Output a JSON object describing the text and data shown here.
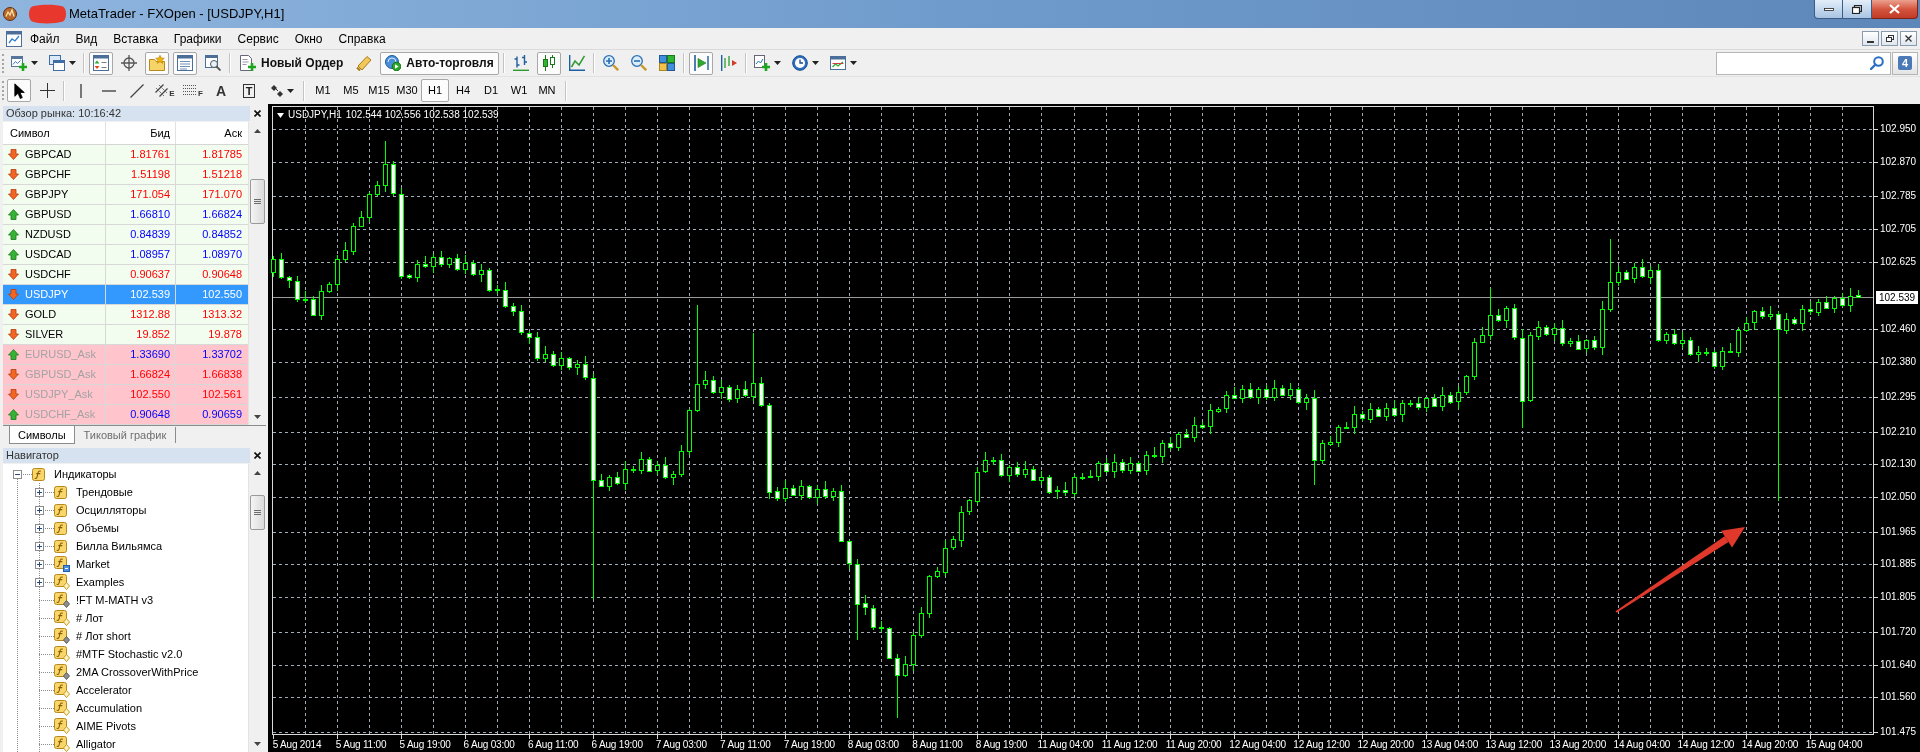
{
  "title_bar": {
    "title": "MetaTrader - FXOpen - [USDJPY,H1]"
  },
  "menu": [
    {
      "label": "Файл"
    },
    {
      "label": "Вид"
    },
    {
      "label": "Вставка"
    },
    {
      "label": "Графики"
    },
    {
      "label": "Сервис"
    },
    {
      "label": "Окно"
    },
    {
      "label": "Справка"
    }
  ],
  "toolbar": {
    "groups": [
      [
        {
          "kind": "new_chart",
          "dropdown": true,
          "pressed": false
        },
        {
          "kind": "profiles",
          "dropdown": true,
          "pressed": false
        }
      ],
      [
        {
          "kind": "market_watch",
          "pressed": true
        },
        {
          "kind": "data_window",
          "pressed": false
        },
        {
          "kind": "navigator",
          "pressed": true
        },
        {
          "kind": "terminal",
          "pressed": true
        },
        {
          "kind": "tester",
          "pressed": false
        }
      ],
      [
        {
          "kind": "new_order",
          "label": "Новый Ордер",
          "pressed": false
        },
        {
          "kind": "experts",
          "pressed": false
        },
        {
          "kind": "autotrading",
          "label": "Авто-торговля",
          "pressed": true
        }
      ],
      [
        {
          "kind": "bar_chart",
          "pressed": false
        },
        {
          "kind": "candle_chart",
          "pressed": true
        },
        {
          "kind": "line_chart",
          "pressed": false
        }
      ],
      [
        {
          "kind": "zoom_in",
          "pressed": false
        },
        {
          "kind": "zoom_out",
          "pressed": false
        },
        {
          "kind": "tile",
          "pressed": false
        }
      ],
      [
        {
          "kind": "autoscroll",
          "pressed": true
        },
        {
          "kind": "chart_shift",
          "pressed": false
        }
      ],
      [
        {
          "kind": "indicators",
          "dropdown": true,
          "pressed": false
        },
        {
          "kind": "periods",
          "dropdown": true,
          "pressed": false
        },
        {
          "kind": "templates",
          "dropdown": true,
          "pressed": false
        }
      ]
    ]
  },
  "messages": {
    "count": "4"
  },
  "drawing_tools": {
    "groups": [
      [
        {
          "kind": "cursor",
          "pressed": true
        },
        {
          "kind": "crosshair",
          "pressed": false
        }
      ],
      [
        {
          "kind": "vertical_line",
          "pressed": false
        },
        {
          "kind": "horizontal_line",
          "pressed": false
        },
        {
          "kind": "trend_line",
          "pressed": false
        },
        {
          "kind": "channel",
          "glyph": "E",
          "pressed": false
        },
        {
          "kind": "fibonacci",
          "glyph": "F",
          "pressed": false
        },
        {
          "kind": "text",
          "glyph": "A",
          "pressed": false
        },
        {
          "kind": "label",
          "glyph": "T",
          "pressed": false
        },
        {
          "kind": "arrows",
          "dropdown": true,
          "pressed": false
        }
      ]
    ]
  },
  "timeframes": [
    {
      "label": "M1",
      "selected": false
    },
    {
      "label": "M5",
      "selected": false
    },
    {
      "label": "M15",
      "selected": false
    },
    {
      "label": "M30",
      "selected": false
    },
    {
      "label": "H1",
      "selected": true
    },
    {
      "label": "H4",
      "selected": false
    },
    {
      "label": "D1",
      "selected": false
    },
    {
      "label": "W1",
      "selected": false
    },
    {
      "label": "MN",
      "selected": false
    }
  ],
  "market_watch": {
    "title": "Обзор рынка: 10:16:42",
    "columns": [
      "Символ",
      "Бид",
      "Аск"
    ],
    "rows": [
      {
        "symbol": "GBPCAD",
        "bid": "1.81761",
        "ask": "1.81785",
        "kind": "down",
        "selected": false,
        "disabled": false
      },
      {
        "symbol": "GBPCHF",
        "bid": "1.51198",
        "ask": "1.51218",
        "kind": "down",
        "selected": false,
        "disabled": false
      },
      {
        "symbol": "GBPJPY",
        "bid": "171.054",
        "ask": "171.070",
        "kind": "down",
        "selected": false,
        "disabled": false
      },
      {
        "symbol": "GBPUSD",
        "bid": "1.66810",
        "ask": "1.66824",
        "kind": "up",
        "selected": false,
        "disabled": false
      },
      {
        "symbol": "NZDUSD",
        "bid": "0.84839",
        "ask": "0.84852",
        "kind": "up",
        "selected": false,
        "disabled": false
      },
      {
        "symbol": "USDCAD",
        "bid": "1.08957",
        "ask": "1.08970",
        "kind": "up",
        "selected": false,
        "disabled": false
      },
      {
        "symbol": "USDCHF",
        "bid": "0.90637",
        "ask": "0.90648",
        "kind": "down",
        "selected": false,
        "disabled": false
      },
      {
        "symbol": "USDJPY",
        "bid": "102.539",
        "ask": "102.550",
        "kind": "down",
        "selected": true,
        "disabled": false
      },
      {
        "symbol": "GOLD",
        "bid": "1312.88",
        "ask": "1313.32",
        "kind": "down",
        "selected": false,
        "disabled": false
      },
      {
        "symbol": "SILVER",
        "bid": "19.852",
        "ask": "19.878",
        "kind": "down",
        "selected": false,
        "disabled": false
      },
      {
        "symbol": "EURUSD_Ask",
        "bid": "1.33690",
        "ask": "1.33702",
        "kind": "up",
        "selected": false,
        "disabled": true
      },
      {
        "symbol": "GBPUSD_Ask",
        "bid": "1.66824",
        "ask": "1.66838",
        "kind": "down",
        "selected": false,
        "disabled": true
      },
      {
        "symbol": "USDJPY_Ask",
        "bid": "102.550",
        "ask": "102.561",
        "kind": "down",
        "selected": false,
        "disabled": true
      },
      {
        "symbol": "USDCHF_Ask",
        "bid": "0.90648",
        "ask": "0.90659",
        "kind": "up",
        "selected": false,
        "disabled": true
      }
    ],
    "tabs": [
      {
        "label": "Символы",
        "selected": true
      },
      {
        "label": "Тиковый график",
        "selected": false
      }
    ]
  },
  "navigator": {
    "title": "Навигатор",
    "tree": [
      {
        "label": "Индикаторы",
        "kind": "category",
        "expanded": true,
        "children": [
          {
            "label": "Трендовые",
            "kind": "category",
            "expanded": false
          },
          {
            "label": "Осцилляторы",
            "kind": "category",
            "expanded": false
          },
          {
            "label": "Объемы",
            "kind": "category",
            "expanded": false
          },
          {
            "label": "Билла Вильямса",
            "kind": "category",
            "expanded": false
          },
          {
            "label": "Market",
            "kind": "market",
            "expanded": false
          },
          {
            "label": "Examples",
            "kind": "source",
            "expanded": false
          },
          {
            "label": "!FT M-MATH v3",
            "kind": "compiled"
          },
          {
            "label": "# Лот",
            "kind": "source"
          },
          {
            "label": "# Лот short",
            "kind": "compiled"
          },
          {
            "label": "#MTF Stochastic v2.0",
            "kind": "source"
          },
          {
            "label": "2MA CrossoverWithPrice",
            "kind": "compiled"
          },
          {
            "label": "Accelerator",
            "kind": "source"
          },
          {
            "label": "Accumulation",
            "kind": "source"
          },
          {
            "label": "AIME Pivots",
            "kind": "source"
          },
          {
            "label": "Alligator",
            "kind": "source"
          }
        ]
      }
    ]
  },
  "chart": {
    "symbol": "USDJPY,H1",
    "quote": "102.544 102.556 102.538 102.539",
    "chart_data": {
      "type": "candlestick",
      "grid": true,
      "ylim": [
        101.469,
        103.005
      ],
      "categories": [
        null,
        null,
        null,
        "5 Aug 2014",
        null,
        null,
        null,
        null,
        null,
        null,
        null,
        "5 Aug 11:00",
        null,
        null,
        null,
        null,
        null,
        null,
        null,
        "5 Aug 19:00",
        null,
        null,
        null,
        null,
        null,
        null,
        null,
        "6 Aug 03:00",
        null,
        null,
        null,
        null,
        null,
        null,
        null,
        "6 Aug 11:00",
        null,
        null,
        null,
        null,
        null,
        null,
        null,
        "6 Aug 19:00",
        null,
        null,
        null,
        null,
        null,
        null,
        null,
        "7 Aug 03:00",
        null,
        null,
        null,
        null,
        null,
        null,
        null,
        "7 Aug 11:00",
        null,
        null,
        null,
        null,
        null,
        null,
        null,
        "7 Aug 19:00",
        null,
        null,
        null,
        null,
        null,
        null,
        null,
        "8 Aug 03:00",
        null,
        null,
        null,
        null,
        null,
        null,
        null,
        "8 Aug 11:00",
        null,
        null,
        null,
        null,
        null,
        null,
        null,
        "8 Aug 19:00",
        null,
        null,
        null,
        null,
        null,
        null,
        null,
        "11 Aug 04:00",
        null,
        null,
        null,
        null,
        null,
        null,
        null,
        "11 Aug 12:00",
        null,
        null,
        null,
        null,
        null,
        null,
        null,
        "11 Aug 20:00",
        null,
        null,
        null,
        null,
        null,
        null,
        null,
        "12 Aug 04:00",
        null,
        null,
        null,
        null,
        null,
        null,
        null,
        "12 Aug 12:00",
        null,
        null,
        null,
        null,
        null,
        null,
        null,
        "12 Aug 20:00",
        null,
        null,
        null,
        null,
        null,
        null,
        null,
        "13 Aug 04:00",
        null,
        null,
        null,
        null,
        null,
        null,
        null,
        "13 Aug 12:00",
        null,
        null,
        null,
        null,
        null,
        null,
        null,
        "13 Aug 20:00",
        null,
        null,
        null,
        null,
        null,
        null,
        null,
        "14 Aug 04:00",
        null,
        null,
        null,
        null,
        null,
        null,
        null,
        "14 Aug 12:00",
        null,
        null,
        null,
        null,
        null,
        null,
        null,
        "14 Aug 20:00",
        null,
        null,
        null,
        null,
        null,
        null,
        null,
        "15 Aug 04:00",
        null,
        null,
        null
      ],
      "ohlc": [
        [
          102.6,
          102.64,
          102.588,
          102.632
        ],
        [
          102.632,
          102.647,
          102.582,
          102.587
        ],
        [
          102.587,
          102.591,
          102.561,
          102.579
        ],
        [
          102.579,
          102.59,
          102.528,
          102.535
        ],
        [
          102.535,
          102.555,
          102.524,
          102.534
        ],
        [
          102.534,
          102.542,
          102.493,
          102.496
        ],
        [
          102.496,
          102.569,
          102.484,
          102.554
        ],
        [
          102.554,
          102.576,
          102.549,
          102.572
        ],
        [
          102.572,
          102.643,
          102.554,
          102.632
        ],
        [
          102.632,
          102.673,
          102.625,
          102.653
        ],
        [
          102.653,
          102.721,
          102.643,
          102.713
        ],
        [
          102.713,
          102.75,
          102.71,
          102.735
        ],
        [
          102.735,
          102.796,
          102.723,
          102.792
        ],
        [
          102.792,
          102.824,
          102.787,
          102.813
        ],
        [
          102.813,
          102.92,
          102.795,
          102.864
        ],
        [
          102.864,
          102.872,
          102.785,
          102.792
        ],
        [
          102.792,
          102.807,
          102.582,
          102.592
        ],
        [
          102.592,
          102.596,
          102.584,
          102.587
        ],
        [
          102.587,
          102.63,
          102.575,
          102.619
        ],
        [
          102.619,
          102.639,
          102.61,
          102.615
        ],
        [
          102.615,
          102.644,
          102.597,
          102.636
        ],
        [
          102.636,
          102.651,
          102.612,
          102.619
        ],
        [
          102.619,
          102.638,
          102.609,
          102.634
        ],
        [
          102.634,
          102.645,
          102.604,
          102.607
        ],
        [
          102.607,
          102.642,
          102.595,
          102.622
        ],
        [
          102.622,
          102.63,
          102.59,
          102.595
        ],
        [
          102.595,
          102.621,
          102.577,
          102.606
        ],
        [
          102.606,
          102.61,
          102.551,
          102.558
        ],
        [
          102.558,
          102.569,
          102.546,
          102.556
        ],
        [
          102.556,
          102.576,
          102.513,
          102.516
        ],
        [
          102.516,
          102.524,
          102.492,
          102.504
        ],
        [
          102.504,
          102.519,
          102.447,
          102.452
        ],
        [
          102.452,
          102.456,
          102.424,
          102.442
        ],
        [
          102.442,
          102.453,
          102.383,
          102.39
        ],
        [
          102.39,
          102.419,
          102.38,
          102.399
        ],
        [
          102.399,
          102.407,
          102.369,
          102.372
        ],
        [
          102.372,
          102.404,
          102.36,
          102.389
        ],
        [
          102.389,
          102.393,
          102.361,
          102.366
        ],
        [
          102.366,
          102.385,
          102.348,
          102.374
        ],
        [
          102.374,
          102.394,
          102.335,
          102.342
        ],
        [
          102.342,
          102.35,
          101.8,
          102.092
        ],
        [
          102.092,
          102.107,
          102.074,
          102.077
        ],
        [
          102.077,
          102.103,
          102.065,
          102.099
        ],
        [
          102.099,
          102.11,
          102.08,
          102.085
        ],
        [
          102.085,
          102.139,
          102.067,
          102.119
        ],
        [
          102.119,
          102.127,
          102.109,
          102.116
        ],
        [
          102.116,
          102.159,
          102.106,
          102.144
        ],
        [
          102.144,
          102.148,
          102.112,
          102.115
        ],
        [
          102.115,
          102.138,
          102.103,
          102.127
        ],
        [
          102.127,
          102.147,
          102.093,
          102.098
        ],
        [
          102.098,
          102.114,
          102.08,
          102.106
        ],
        [
          102.106,
          102.177,
          102.099,
          102.162
        ],
        [
          102.162,
          102.266,
          102.152,
          102.262
        ],
        [
          102.262,
          102.52,
          102.259,
          102.326
        ],
        [
          102.326,
          102.357,
          102.314,
          102.337
        ],
        [
          102.337,
          102.345,
          102.302,
          102.307
        ],
        [
          102.307,
          102.335,
          102.289,
          102.32
        ],
        [
          102.32,
          102.324,
          102.283,
          102.29
        ],
        [
          102.29,
          102.324,
          102.28,
          102.313
        ],
        [
          102.313,
          102.333,
          102.295,
          102.298
        ],
        [
          102.298,
          102.45,
          102.286,
          102.329
        ],
        [
          102.329,
          102.344,
          102.271,
          102.276
        ],
        [
          102.276,
          102.28,
          102.046,
          102.064
        ],
        [
          102.064,
          102.075,
          102.04,
          102.047
        ],
        [
          102.047,
          102.092,
          102.037,
          102.072
        ],
        [
          102.072,
          102.08,
          102.052,
          102.055
        ],
        [
          102.055,
          102.091,
          102.043,
          102.076
        ],
        [
          102.076,
          102.08,
          102.045,
          102.05
        ],
        [
          102.05,
          102.08,
          102.032,
          102.069
        ],
        [
          102.069,
          102.089,
          102.044,
          102.051
        ],
        [
          102.051,
          102.072,
          102.041,
          102.064
        ],
        [
          102.064,
          102.079,
          101.939,
          101.942
        ],
        [
          101.942,
          101.946,
          101.875,
          101.887
        ],
        [
          101.887,
          101.898,
          101.7,
          101.79
        ],
        [
          101.79,
          101.81,
          101.761,
          101.779
        ],
        [
          101.779,
          101.787,
          101.725,
          101.732
        ],
        [
          101.732,
          101.747,
          101.719,
          101.729
        ],
        [
          101.729,
          101.733,
          101.653,
          101.656
        ],
        [
          101.656,
          101.667,
          101.51,
          101.614
        ],
        [
          101.614,
          101.662,
          101.609,
          101.642
        ],
        [
          101.642,
          101.72,
          101.624,
          101.712
        ],
        [
          101.712,
          101.78,
          101.705,
          101.765
        ],
        [
          101.765,
          101.86,
          101.755,
          101.856
        ],
        [
          101.856,
          101.879,
          101.853,
          101.868
        ],
        [
          101.868,
          101.946,
          101.856,
          101.926
        ],
        [
          101.926,
          101.954,
          101.921,
          101.946
        ],
        [
          101.946,
          102.029,
          101.928,
          102.014
        ],
        [
          102.014,
          102.046,
          102.007,
          102.042
        ],
        [
          102.042,
          102.123,
          102.032,
          102.112
        ],
        [
          102.112,
          102.16,
          102.109,
          102.14
        ],
        [
          102.14,
          102.149,
          102.128,
          102.141
        ],
        [
          102.141,
          102.156,
          102.1,
          102.105
        ],
        [
          102.105,
          102.128,
          102.087,
          102.124
        ],
        [
          102.124,
          102.135,
          102.099,
          102.106
        ],
        [
          102.106,
          102.139,
          102.096,
          102.119
        ],
        [
          102.119,
          102.127,
          102.089,
          102.092
        ],
        [
          102.092,
          102.114,
          102.08,
          102.099
        ],
        [
          102.099,
          102.103,
          102.058,
          102.063
        ],
        [
          102.063,
          102.077,
          102.045,
          102.066
        ],
        [
          102.066,
          102.086,
          102.053,
          102.06
        ],
        [
          102.06,
          102.107,
          102.05,
          102.099
        ],
        [
          102.099,
          102.108,
          102.091,
          102.099
        ],
        [
          102.099,
          102.116,
          102.096,
          102.101
        ],
        [
          102.101,
          102.138,
          102.089,
          102.134
        ],
        [
          102.134,
          102.145,
          102.109,
          102.114
        ],
        [
          102.114,
          102.156,
          102.096,
          102.136
        ],
        [
          102.136,
          102.144,
          102.109,
          102.116
        ],
        [
          102.116,
          102.149,
          102.106,
          102.134
        ],
        [
          102.134,
          102.138,
          102.112,
          102.115
        ],
        [
          102.115,
          102.163,
          102.103,
          102.152
        ],
        [
          102.152,
          102.172,
          102.146,
          102.151
        ],
        [
          102.151,
          102.19,
          102.133,
          102.182
        ],
        [
          102.182,
          102.197,
          102.165,
          102.172
        ],
        [
          102.172,
          102.209,
          102.162,
          102.205
        ],
        [
          102.205,
          102.216,
          102.194,
          102.197
        ],
        [
          102.197,
          102.246,
          102.185,
          102.226
        ],
        [
          102.226,
          102.234,
          102.217,
          102.222
        ],
        [
          102.222,
          102.277,
          102.204,
          102.262
        ],
        [
          102.262,
          102.27,
          102.255,
          102.266
        ],
        [
          102.266,
          102.31,
          102.256,
          102.299
        ],
        [
          102.299,
          102.319,
          102.289,
          102.292
        ],
        [
          102.292,
          102.323,
          102.28,
          102.315
        ],
        [
          102.315,
          102.33,
          102.29,
          102.295
        ],
        [
          102.295,
          102.318,
          102.277,
          102.314
        ],
        [
          102.314,
          102.325,
          102.288,
          102.295
        ],
        [
          102.295,
          102.336,
          102.285,
          102.316
        ],
        [
          102.316,
          102.324,
          102.296,
          102.299
        ],
        [
          102.299,
          102.329,
          102.287,
          102.314
        ],
        [
          102.314,
          102.318,
          102.277,
          102.282
        ],
        [
          102.282,
          102.303,
          102.264,
          102.292
        ],
        [
          102.292,
          102.312,
          102.08,
          102.14
        ],
        [
          102.14,
          102.189,
          102.13,
          102.181
        ],
        [
          102.181,
          102.2,
          102.178,
          102.185
        ],
        [
          102.185,
          102.226,
          102.173,
          102.222
        ],
        [
          102.222,
          102.233,
          102.216,
          102.221
        ],
        [
          102.221,
          102.272,
          102.203,
          102.252
        ],
        [
          102.252,
          102.26,
          102.235,
          102.242
        ],
        [
          102.242,
          102.281,
          102.232,
          102.266
        ],
        [
          102.266,
          102.27,
          102.245,
          102.248
        ],
        [
          102.248,
          102.279,
          102.236,
          102.268
        ],
        [
          102.268,
          102.288,
          102.246,
          102.251
        ],
        [
          102.251,
          102.287,
          102.233,
          102.279
        ],
        [
          102.279,
          102.288,
          102.27,
          102.279
        ],
        [
          102.279,
          102.294,
          102.262,
          102.269
        ],
        [
          102.269,
          102.295,
          102.259,
          102.291
        ],
        [
          102.291,
          102.302,
          102.269,
          102.272
        ],
        [
          102.272,
          102.319,
          102.26,
          102.299
        ],
        [
          102.299,
          102.307,
          102.278,
          102.283
        ],
        [
          102.283,
          102.321,
          102.265,
          102.306
        ],
        [
          102.306,
          102.349,
          102.299,
          102.345
        ],
        [
          102.345,
          102.44,
          102.335,
          102.429
        ],
        [
          102.429,
          102.466,
          102.426,
          102.446
        ],
        [
          102.446,
          102.56,
          102.434,
          102.494
        ],
        [
          102.494,
          102.509,
          102.477,
          102.482
        ],
        [
          102.482,
          102.516,
          102.464,
          102.512
        ],
        [
          102.512,
          102.523,
          102.433,
          102.44
        ],
        [
          102.44,
          102.46,
          102.22,
          102.286
        ],
        [
          102.286,
          102.453,
          102.283,
          102.445
        ],
        [
          102.445,
          102.481,
          102.433,
          102.466
        ],
        [
          102.466,
          102.47,
          102.444,
          102.449
        ],
        [
          102.449,
          102.475,
          102.431,
          102.464
        ],
        [
          102.464,
          102.484,
          102.42,
          102.427
        ],
        [
          102.427,
          102.44,
          102.417,
          102.432
        ],
        [
          102.432,
          102.447,
          102.41,
          102.413
        ],
        [
          102.413,
          102.437,
          102.401,
          102.433
        ],
        [
          102.433,
          102.444,
          102.41,
          102.415
        ],
        [
          102.415,
          102.529,
          102.397,
          102.509
        ],
        [
          102.509,
          102.68,
          102.502,
          102.576
        ],
        [
          102.576,
          102.616,
          102.566,
          102.601
        ],
        [
          102.601,
          102.605,
          102.582,
          102.585
        ],
        [
          102.585,
          102.623,
          102.573,
          102.612
        ],
        [
          102.612,
          102.632,
          102.585,
          102.59
        ],
        [
          102.59,
          102.614,
          102.572,
          102.606
        ],
        [
          102.606,
          102.621,
          102.428,
          102.435
        ],
        [
          102.435,
          102.453,
          102.425,
          102.449
        ],
        [
          102.449,
          102.46,
          102.423,
          102.426
        ],
        [
          102.426,
          102.454,
          102.414,
          102.434
        ],
        [
          102.434,
          102.442,
          102.394,
          102.399
        ],
        [
          102.399,
          102.42,
          102.381,
          102.405
        ],
        [
          102.405,
          102.414,
          102.396,
          102.405
        ],
        [
          102.405,
          102.409,
          102.363,
          102.37
        ],
        [
          102.37,
          102.417,
          102.36,
          102.406
        ],
        [
          102.406,
          102.426,
          102.402,
          102.405
        ],
        [
          102.405,
          102.467,
          102.393,
          102.459
        ],
        [
          102.459,
          102.491,
          102.454,
          102.476
        ],
        [
          102.476,
          102.508,
          102.458,
          102.504
        ],
        [
          102.504,
          102.515,
          102.485,
          102.492
        ],
        [
          102.492,
          102.517,
          102.482,
          102.497
        ],
        [
          102.497,
          102.505,
          102.04,
          102.46
        ],
        [
          102.46,
          102.501,
          102.448,
          102.486
        ],
        [
          102.486,
          102.49,
          102.47,
          102.475
        ],
        [
          102.475,
          102.52,
          102.457,
          102.509
        ],
        [
          102.509,
          102.529,
          102.496,
          102.503
        ],
        [
          102.503,
          102.535,
          102.493,
          102.527
        ],
        [
          102.527,
          102.542,
          102.509,
          102.512
        ],
        [
          102.512,
          102.541,
          102.5,
          102.537
        ],
        [
          102.537,
          102.548,
          102.515,
          102.52
        ],
        [
          102.52,
          102.561,
          102.502,
          102.541
        ],
        [
          102.544,
          102.556,
          102.538,
          102.539
        ]
      ],
      "yticks": [
        {
          "value": 102.95,
          "label": "102.950"
        },
        {
          "value": 102.87,
          "label": "102.870"
        },
        {
          "value": 102.785,
          "label": "102.785"
        },
        {
          "value": 102.705,
          "label": "102.705"
        },
        {
          "value": 102.625,
          "label": "102.625"
        },
        {
          "value": 102.46,
          "label": "102.460"
        },
        {
          "value": 102.38,
          "label": "102.380"
        },
        {
          "value": 102.295,
          "label": "102.295"
        },
        {
          "value": 102.21,
          "label": "102.210"
        },
        {
          "value": 102.13,
          "label": "102.130"
        },
        {
          "value": 102.05,
          "label": "102.050"
        },
        {
          "value": 101.965,
          "label": "101.965"
        },
        {
          "value": 101.885,
          "label": "101.885"
        },
        {
          "value": 101.805,
          "label": "101.805"
        },
        {
          "value": 101.72,
          "label": "101.720"
        },
        {
          "value": 101.64,
          "label": "101.640"
        },
        {
          "value": 101.56,
          "label": "101.560"
        },
        {
          "value": 101.475,
          "label": "101.475"
        }
      ],
      "ref_lines": [
        {
          "axis": "y",
          "value": 102.539,
          "label": "102.539"
        }
      ]
    }
  }
}
